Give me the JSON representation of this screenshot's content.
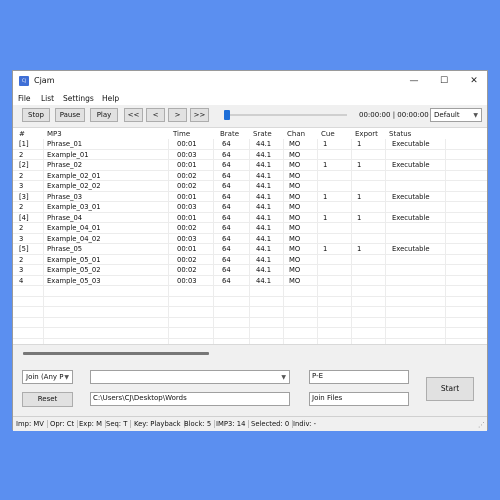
{
  "window": {
    "title": "Cjam",
    "icon": "app-icon"
  },
  "window_controls": {
    "minimize": "—",
    "maximize": "☐",
    "close": "✕"
  },
  "menu": [
    "File",
    "List",
    "Settings",
    "Help"
  ],
  "toolbar": {
    "stop": "Stop",
    "pause": "Pause",
    "play": "Play",
    "first": "<<",
    "prev": "<",
    "next": ">",
    "last": ">>",
    "position": "00:00:00",
    "duration": "| 00:00:00",
    "preset": "Default"
  },
  "columns": [
    "#",
    "MP3",
    "Time",
    "Brate",
    "Srate",
    "Chan",
    "Cue",
    "Export",
    "Status"
  ],
  "rows": [
    [
      "[1]",
      "Phrase_01",
      "00:01",
      "64",
      "44.1",
      "MO",
      "1",
      "1",
      "Executable"
    ],
    [
      "2",
      "Example_01",
      "00:03",
      "64",
      "44.1",
      "MO",
      "",
      "",
      ""
    ],
    [
      "[2]",
      "Phrase_02",
      "00:01",
      "64",
      "44.1",
      "MO",
      "1",
      "1",
      "Executable"
    ],
    [
      "2",
      "Example_02_01",
      "00:02",
      "64",
      "44.1",
      "MO",
      "",
      "",
      ""
    ],
    [
      "3",
      "Example_02_02",
      "00:02",
      "64",
      "44.1",
      "MO",
      "",
      "",
      ""
    ],
    [
      "[3]",
      "Phrase_03",
      "00:01",
      "64",
      "44.1",
      "MO",
      "1",
      "1",
      "Executable"
    ],
    [
      "2",
      "Example_03_01",
      "00:03",
      "64",
      "44.1",
      "MO",
      "",
      "",
      ""
    ],
    [
      "[4]",
      "Phrase_04",
      "00:01",
      "64",
      "44.1",
      "MO",
      "1",
      "1",
      "Executable"
    ],
    [
      "2",
      "Example_04_01",
      "00:02",
      "64",
      "44.1",
      "MO",
      "",
      "",
      ""
    ],
    [
      "3",
      "Example_04_02",
      "00:03",
      "64",
      "44.1",
      "MO",
      "",
      "",
      ""
    ],
    [
      "[5]",
      "Phrase_05",
      "00:01",
      "64",
      "44.1",
      "MO",
      "1",
      "1",
      "Executable"
    ],
    [
      "2",
      "Example_05_01",
      "00:02",
      "64",
      "44.1",
      "MO",
      "",
      "",
      ""
    ],
    [
      "3",
      "Example_05_02",
      "00:02",
      "64",
      "44.1",
      "MO",
      "",
      "",
      ""
    ],
    [
      "4",
      "Example_05_03",
      "00:03",
      "64",
      "44.1",
      "MO",
      "",
      "",
      ""
    ]
  ],
  "bottom": {
    "join_mode": "Join (Any P",
    "combo_value": "",
    "reset": "Reset",
    "path": "C:\\Users\\CJ\\Desktop\\Words",
    "pe_value": "P-E",
    "join_files_value": "Join Files",
    "start": "Start"
  },
  "status": [
    "Imp: MV",
    "Opr: Ct",
    "Exp: M",
    "Seq: T",
    "Key: Playback",
    "Block: 5",
    "IMP3: 14",
    "Selected: 0",
    "Indiv: -"
  ],
  "colors": {
    "desktop": "#5b8ff0",
    "accent": "#1e6fd8"
  }
}
